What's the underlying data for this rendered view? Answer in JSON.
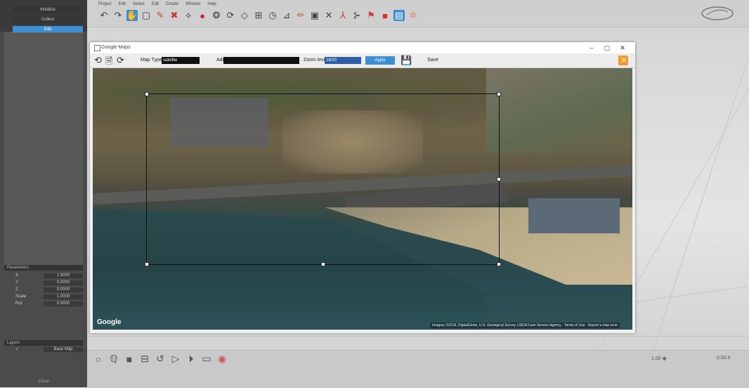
{
  "left_panel": {
    "top_buttons": [
      "Initialize",
      "Collect",
      "Edit"
    ],
    "section_params": "Parameters",
    "param_rows": [
      {
        "key": "X",
        "value": "1.0000"
      },
      {
        "key": "Y",
        "value": "0.0000"
      },
      {
        "key": "Z",
        "value": "0.0000"
      },
      {
        "key": "Scale",
        "value": "1.0000"
      },
      {
        "key": "Rot",
        "value": "0.0000"
      }
    ],
    "section_layers": "Layers",
    "layer_row": {
      "key": "✓",
      "value": "Base Map"
    },
    "bottom_label": "Close"
  },
  "menu": [
    "Project",
    "Edit",
    "Select",
    "Edit",
    "Create",
    "Window",
    "Help"
  ],
  "toolbar_icons": [
    "undo-icon",
    "redo-icon",
    "hand-icon",
    "select-box-icon",
    "brush-icon",
    "x-pin-icon",
    "lasso-icon",
    "paint-icon",
    "sphere-icon",
    "rotate-icon",
    "diamond-icon",
    "grid-icon",
    "clock-icon",
    "measure-icon",
    "pencil-icon",
    "square-icon",
    "cross-icon",
    "axis-icon",
    "tree-icon",
    "flag-icon",
    "cube-icon",
    "layers-icon",
    "settings-icon"
  ],
  "map_window": {
    "title": "Google Maps",
    "map_type_label": "Map Type",
    "map_type_value": "satellite",
    "address_label": "Address",
    "address_value": "",
    "zoom_label": "Zoom level",
    "zoom_value": "18/20",
    "apply_label": "Apply",
    "save_label": "Save",
    "google_logo": "Google",
    "copyright": "Imagery ©2019, DigitalGlobe, U.S. Geological Survey, USDA Farm Service Agency · Terms of Use · Report a map error"
  },
  "bottom": {
    "zoom_text": "1.00 ◉",
    "coords_text": "0.00.0"
  }
}
